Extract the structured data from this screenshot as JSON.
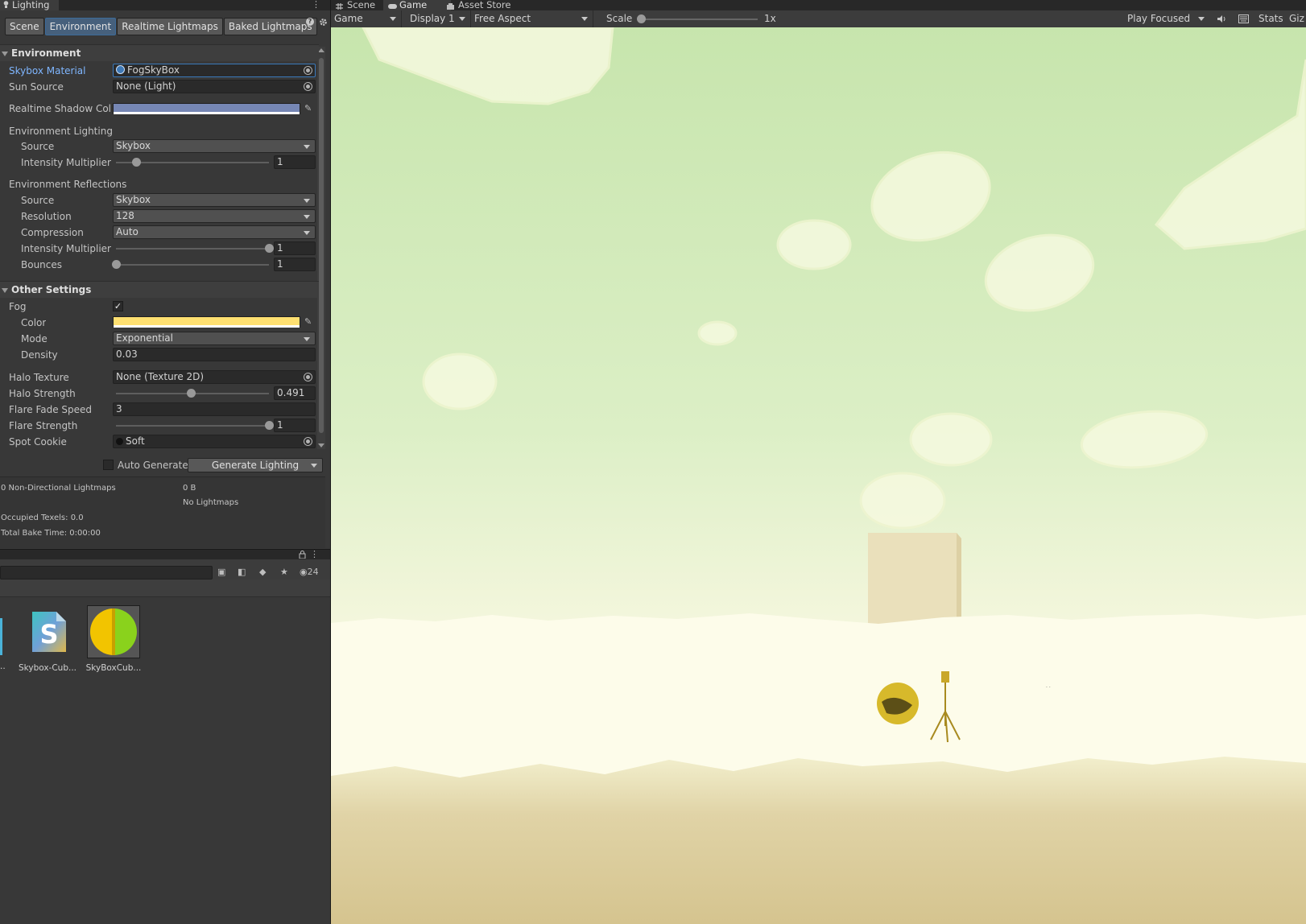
{
  "lighting": {
    "window_tab": "Lighting",
    "tabs": [
      {
        "label": "Scene",
        "active": false
      },
      {
        "label": "Environment",
        "active": true
      },
      {
        "label": "Realtime Lightmaps",
        "active": false
      },
      {
        "label": "Baked Lightmaps",
        "active": false
      }
    ],
    "environment": {
      "header": "Environment",
      "skybox_material_label": "Skybox Material",
      "skybox_material_value": "FogSkyBox",
      "sun_source_label": "Sun Source",
      "sun_source_value": "None (Light)",
      "shadow_color_label": "Realtime Shadow Color",
      "shadow_color": "#7687b5",
      "env_lighting_label": "Environment Lighting",
      "lighting_source_label": "Source",
      "lighting_source_value": "Skybox",
      "lighting_intensity_label": "Intensity Multiplier",
      "lighting_intensity_value": "1",
      "lighting_intensity_fraction": 0.13,
      "env_reflections_label": "Environment Reflections",
      "refl_source_label": "Source",
      "refl_source_value": "Skybox",
      "resolution_label": "Resolution",
      "resolution_value": "128",
      "compression_label": "Compression",
      "compression_value": "Auto",
      "refl_intensity_label": "Intensity Multiplier",
      "refl_intensity_value": "1",
      "refl_intensity_fraction": 1.0,
      "bounces_label": "Bounces",
      "bounces_value": "1",
      "bounces_fraction": 0.0
    },
    "other": {
      "header": "Other Settings",
      "fog_label": "Fog",
      "fog_checked": true,
      "color_label": "Color",
      "fog_color": "#ffe071",
      "mode_label": "Mode",
      "mode_value": "Exponential",
      "density_label": "Density",
      "density_value": "0.03",
      "halo_texture_label": "Halo Texture",
      "halo_texture_value": "None (Texture 2D)",
      "halo_strength_label": "Halo Strength",
      "halo_strength_value": "0.491",
      "halo_strength_fraction": 0.491,
      "flare_fade_label": "Flare Fade Speed",
      "flare_fade_value": "3",
      "flare_strength_label": "Flare Strength",
      "flare_strength_value": "1",
      "flare_strength_fraction": 1.0,
      "spot_cookie_label": "Spot Cookie",
      "spot_cookie_value": "Soft"
    },
    "auto_generate_label": "Auto Generate",
    "auto_generate_checked": false,
    "generate_button": "Generate Lighting",
    "stats": {
      "lightmaps": "0 Non-Directional Lightmaps",
      "size": "0 B",
      "no_lightmaps": "No Lightmaps",
      "texels": "Occupied Texels: 0.0",
      "bake_time": "Total Bake Time: 0:00:00"
    }
  },
  "project": {
    "visible_count": "24",
    "assets": [
      {
        "name": "Skybox-Cub...",
        "icon": "shader-icon"
      },
      {
        "name": "SkyBoxCub...",
        "icon": "material-icon"
      }
    ]
  },
  "game": {
    "tabs": [
      {
        "label": "Scene",
        "icon": "scene-icon",
        "active": false
      },
      {
        "label": "Game",
        "icon": "game-controller-icon",
        "active": true
      },
      {
        "label": "Asset Store",
        "icon": "store-icon",
        "active": false
      }
    ],
    "mode_dropdown": "Game",
    "display_dropdown": "Display 1",
    "aspect_dropdown": "Free Aspect",
    "scale_label": "Scale",
    "scale_value": "1x",
    "play_mode": "Play Focused",
    "stats_label": "Stats",
    "gizmos_label": "Giz",
    "sky_top_color": "#c9e6b0",
    "fog_color": "#fbf9e6",
    "ground_color": "#d9c998"
  }
}
